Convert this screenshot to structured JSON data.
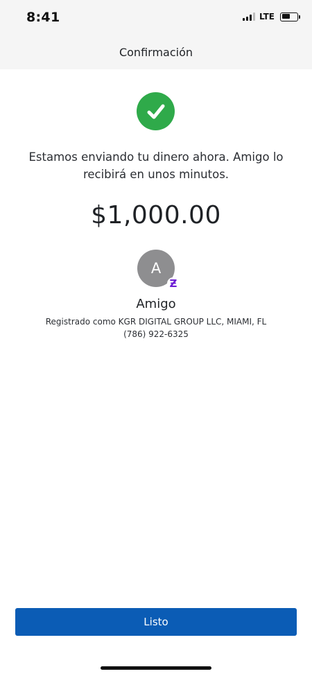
{
  "status_bar": {
    "time": "8:41",
    "network": "LTE",
    "signal_bars_active": 3,
    "signal_bars_total": 4,
    "battery_level": 0.55
  },
  "header": {
    "title": "Confirmación"
  },
  "confirmation": {
    "icon": "check-circle-icon",
    "message": "Estamos enviando tu dinero ahora. Amigo lo recibirá en unos minutos.",
    "amount": "$1,000.00"
  },
  "recipient": {
    "avatar_initial": "A",
    "badge_icon": "zelle-icon",
    "badge_glyph": "Ƶ",
    "name": "Amigo",
    "registered_as": "Registrado como KGR DIGITAL GROUP LLC, MIAMI, FL",
    "phone": "(786) 922-6325"
  },
  "actions": {
    "done_label": "Listo"
  },
  "colors": {
    "success": "#2faa4a",
    "primary": "#0b5cb5",
    "zelle": "#6d1ed4",
    "avatar": "#8e8e90",
    "header_bg": "#f5f5f5"
  }
}
